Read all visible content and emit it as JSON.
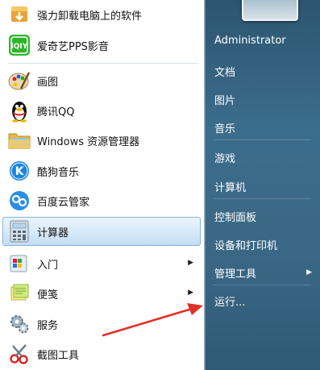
{
  "left_menu": {
    "items": [
      {
        "label": "强力卸载电脑上的软件",
        "icon": "uninstall-icon",
        "arrow": false,
        "selected": false
      },
      {
        "label": "爱奇艺PPS影音",
        "icon": "iqiyi-icon",
        "arrow": false,
        "selected": false
      },
      {
        "label": "画图",
        "icon": "paint-palette-icon",
        "arrow": false,
        "selected": false
      },
      {
        "label": "腾讯QQ",
        "icon": "qq-penguin-icon",
        "arrow": false,
        "selected": false
      },
      {
        "label": "Windows 资源管理器",
        "icon": "folder-icon",
        "arrow": false,
        "selected": false
      },
      {
        "label": "酷狗音乐",
        "icon": "kugou-icon",
        "arrow": false,
        "selected": false
      },
      {
        "label": "百度云管家",
        "icon": "baidu-cloud-icon",
        "arrow": false,
        "selected": false
      },
      {
        "label": "计算器",
        "icon": "calculator-icon",
        "arrow": false,
        "selected": true
      },
      {
        "label": "入门",
        "icon": "getting-started-icon",
        "arrow": true,
        "selected": false
      },
      {
        "label": "便笺",
        "icon": "sticky-notes-icon",
        "arrow": true,
        "selected": false
      },
      {
        "label": "服务",
        "icon": "services-gear-icon",
        "arrow": false,
        "selected": false
      },
      {
        "label": "截图工具",
        "icon": "scissors-icon",
        "arrow": false,
        "selected": false
      }
    ]
  },
  "right_menu": {
    "items": [
      {
        "label": "Administrator",
        "arrow": false
      },
      {
        "label": "文档",
        "arrow": false
      },
      {
        "label": "图片",
        "arrow": false
      },
      {
        "label": "音乐",
        "arrow": false
      },
      {
        "label": "游戏",
        "arrow": false
      },
      {
        "label": "计算机",
        "arrow": false
      },
      {
        "label": "控制面板",
        "arrow": false
      },
      {
        "label": "设备和打印机",
        "arrow": false
      },
      {
        "label": "管理工具",
        "arrow": true
      },
      {
        "label": "运行...",
        "arrow": false
      }
    ]
  },
  "colors": {
    "arrow_red": "#e0302a",
    "selection_border": "#86b2d8"
  }
}
